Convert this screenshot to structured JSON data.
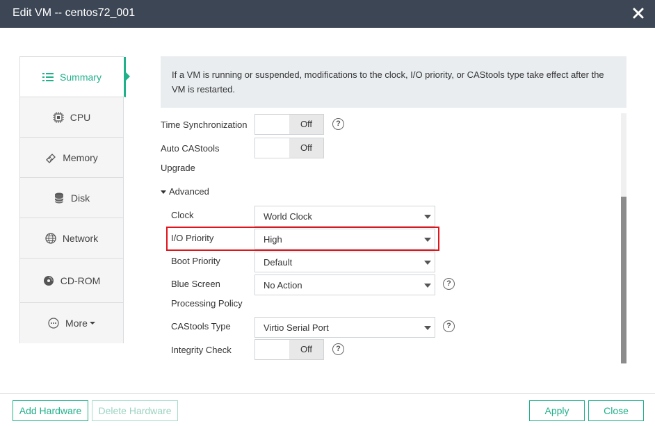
{
  "window": {
    "title": "Edit VM -- centos72_001"
  },
  "nav": {
    "items": [
      {
        "label": "Summary",
        "icon": "list-icon"
      },
      {
        "label": "CPU",
        "icon": "cpu-icon"
      },
      {
        "label": "Memory",
        "icon": "memory-icon"
      },
      {
        "label": "Disk",
        "icon": "disk-icon"
      },
      {
        "label": "Network",
        "icon": "globe-icon"
      },
      {
        "label": "CD-ROM",
        "icon": "cdrom-icon"
      },
      {
        "label": "More",
        "icon": "more-icon"
      }
    ],
    "active": "Summary",
    "accent": "#20b08a"
  },
  "info": {
    "text": "If a VM is running or suspended, modifications to the clock, I/O priority, or CAStools type take effect after the VM is restarted."
  },
  "settings": {
    "time_sync": {
      "label": "Time Synchronization",
      "value": "Off"
    },
    "auto_castools": {
      "label_line1": "Auto CAStools",
      "label_line2": "Upgrade",
      "value": "Off"
    },
    "advanced": {
      "label": "Advanced"
    },
    "clock": {
      "label": "Clock",
      "value": "World Clock"
    },
    "io_priority": {
      "label": "I/O Priority",
      "value": "High"
    },
    "boot_priority": {
      "label": "Boot Priority",
      "value": "Default"
    },
    "blue_screen": {
      "label_line1": "Blue Screen",
      "label_line2": "Processing Policy",
      "value": "No Action"
    },
    "castools_type": {
      "label": "CAStools Type",
      "value": "Virtio Serial Port"
    },
    "integrity_check": {
      "label": "Integrity Check",
      "value": "Off"
    }
  },
  "footer": {
    "add_hardware": "Add Hardware",
    "delete_hardware": "Delete Hardware",
    "apply": "Apply",
    "close": "Close"
  },
  "colors": {
    "titlebar": "#3c4654",
    "highlight": "#e0141b"
  }
}
